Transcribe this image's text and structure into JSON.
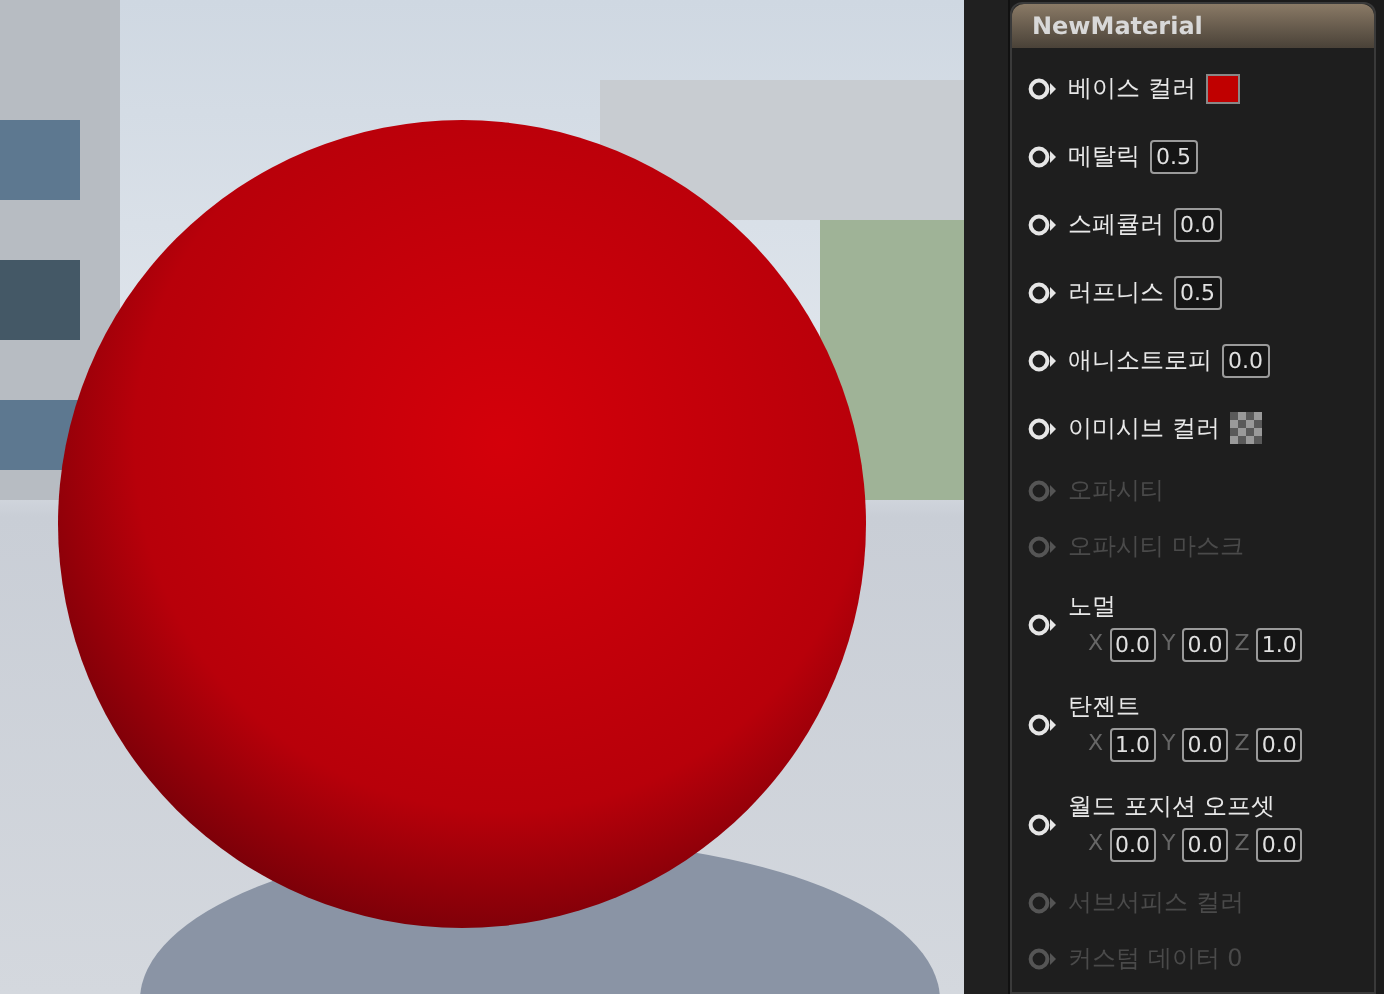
{
  "node": {
    "title": "NewMaterial",
    "pins": [
      {
        "label": "베이스 컬러",
        "kind": "color",
        "enabled": true,
        "color": "#c00000"
      },
      {
        "label": "메탈릭",
        "kind": "scalar",
        "enabled": true,
        "value": "0.5"
      },
      {
        "label": "스페큘러",
        "kind": "scalar",
        "enabled": true,
        "value": "0.0"
      },
      {
        "label": "러프니스",
        "kind": "scalar",
        "enabled": true,
        "value": "0.5"
      },
      {
        "label": "애니소트로피",
        "kind": "scalar",
        "enabled": true,
        "value": "0.0"
      },
      {
        "label": "이미시브 컬러",
        "kind": "texture",
        "enabled": true
      },
      {
        "label": "오파시티",
        "kind": "none",
        "enabled": false
      },
      {
        "label": "오파시티 마스크",
        "kind": "none",
        "enabled": false
      },
      {
        "label": "노멀",
        "kind": "vector",
        "enabled": true,
        "components": [
          {
            "axis": "X",
            "value": "0.0"
          },
          {
            "axis": "Y",
            "value": "0.0"
          },
          {
            "axis": "Z",
            "value": "1.0"
          }
        ]
      },
      {
        "label": "탄젠트",
        "kind": "vector",
        "enabled": true,
        "components": [
          {
            "axis": "X",
            "value": "1.0"
          },
          {
            "axis": "Y",
            "value": "0.0"
          },
          {
            "axis": "Z",
            "value": "0.0"
          }
        ]
      },
      {
        "label": "월드 포지션 오프셋",
        "kind": "vector",
        "enabled": true,
        "components": [
          {
            "axis": "X",
            "value": "0.0"
          },
          {
            "axis": "Y",
            "value": "0.0"
          },
          {
            "axis": "Z",
            "value": "0.0"
          }
        ]
      },
      {
        "label": "서브서피스 컬러",
        "kind": "none",
        "enabled": false
      },
      {
        "label": "커스텀 데이터 0",
        "kind": "none",
        "enabled": false
      }
    ]
  }
}
